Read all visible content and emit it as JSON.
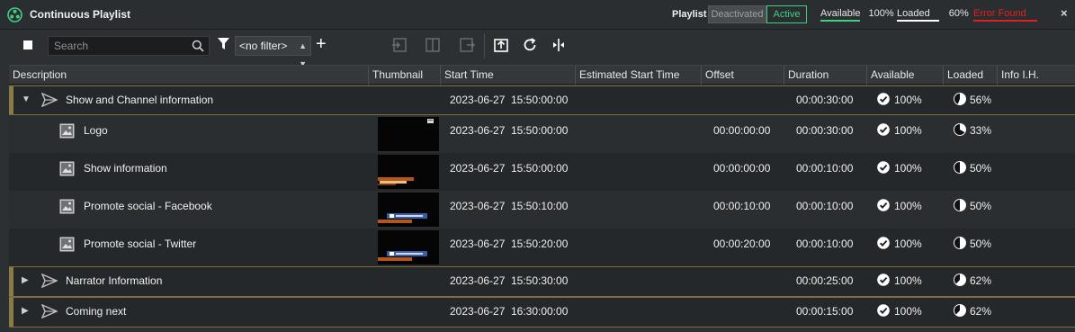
{
  "window": {
    "title": "Continuous Playlist",
    "playlist_label": "Playlist",
    "toggle_deactivated": "Deactivated",
    "toggle_active": "Active",
    "available_label": "Available",
    "available_value": "100%",
    "loaded_label": "Loaded",
    "loaded_value": "60%",
    "error_label": "Error Found",
    "close_symbol": "×",
    "colors": {
      "active": "#3fcf7f",
      "error": "#e02020",
      "group_accent": "#8a7a45"
    }
  },
  "toolbar": {
    "search_placeholder": "Search",
    "filter_value": "<no filter>",
    "add_symbol": "+"
  },
  "columns": [
    "Description",
    "Thumbnail",
    "Start Time",
    "Estimated Start Time",
    "Offset",
    "Duration",
    "Available",
    "Loaded",
    "Info I.H."
  ],
  "rows": [
    {
      "type": "group",
      "expanded": true,
      "description": "Show and Channel information",
      "start_date": "2023-06-27",
      "start_time": "15:50:00:00",
      "offset": "",
      "duration": "00:00:30:00",
      "available": "100%",
      "loaded": "56%",
      "loaded_fraction": 0.56
    },
    {
      "type": "item",
      "description": "Logo",
      "start_date": "2023-06-27",
      "start_time": "15:50:00:00",
      "offset": "00:00:00:00",
      "duration": "00:00:30:00",
      "available": "100%",
      "loaded": "33%",
      "loaded_fraction": 0.33,
      "thumb": "logo"
    },
    {
      "type": "item",
      "description": "Show information",
      "start_date": "2023-06-27",
      "start_time": "15:50:00:00",
      "offset": "00:00:00:00",
      "duration": "00:00:10:00",
      "available": "100%",
      "loaded": "50%",
      "loaded_fraction": 0.5,
      "thumb": "lower-third"
    },
    {
      "type": "item",
      "description": "Promote social - Facebook",
      "start_date": "2023-06-27",
      "start_time": "15:50:10:00",
      "offset": "00:00:10:00",
      "duration": "00:00:10:00",
      "available": "100%",
      "loaded": "50%",
      "loaded_fraction": 0.5,
      "thumb": "social"
    },
    {
      "type": "item",
      "description": "Promote social - Twitter",
      "start_date": "2023-06-27",
      "start_time": "15:50:20:00",
      "offset": "00:00:20:00",
      "duration": "00:00:10:00",
      "available": "100%",
      "loaded": "50%",
      "loaded_fraction": 0.5,
      "thumb": "social"
    },
    {
      "type": "group",
      "expanded": false,
      "description": "Narrator Information",
      "start_date": "2023-06-27",
      "start_time": "15:50:30:00",
      "offset": "",
      "duration": "00:00:25:00",
      "available": "100%",
      "loaded": "62%",
      "loaded_fraction": 0.62
    },
    {
      "type": "group",
      "expanded": false,
      "description": "Coming next",
      "start_date": "2023-06-27",
      "start_time": "16:30:00:00",
      "offset": "",
      "duration": "00:00:15:00",
      "available": "100%",
      "loaded": "62%",
      "loaded_fraction": 0.62
    }
  ]
}
